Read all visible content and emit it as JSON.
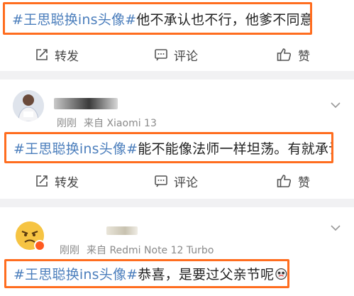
{
  "posts": [
    {
      "topic": "#王思聪换ins头像#",
      "text": "他不承认也不行，他爹不同意。"
    },
    {
      "time": "刚刚",
      "source": "来自 Xiaomi 13",
      "topic": "#王思聪换ins头像#",
      "text": "能不能像法师一样坦荡。有就承认"
    },
    {
      "time": "刚刚",
      "source": "来自 Redmi Note 12 Turbo",
      "topic": "#王思聪换ins头像#",
      "text": "恭喜，是要过父亲节呢"
    }
  ],
  "actions": {
    "repost_label": "转发",
    "comment_label": "评论",
    "like_label": "赞"
  },
  "colors": {
    "highlight_border": "#ff6d1f",
    "topic": "#4b7ebc",
    "separator": "#f1f1f3"
  }
}
